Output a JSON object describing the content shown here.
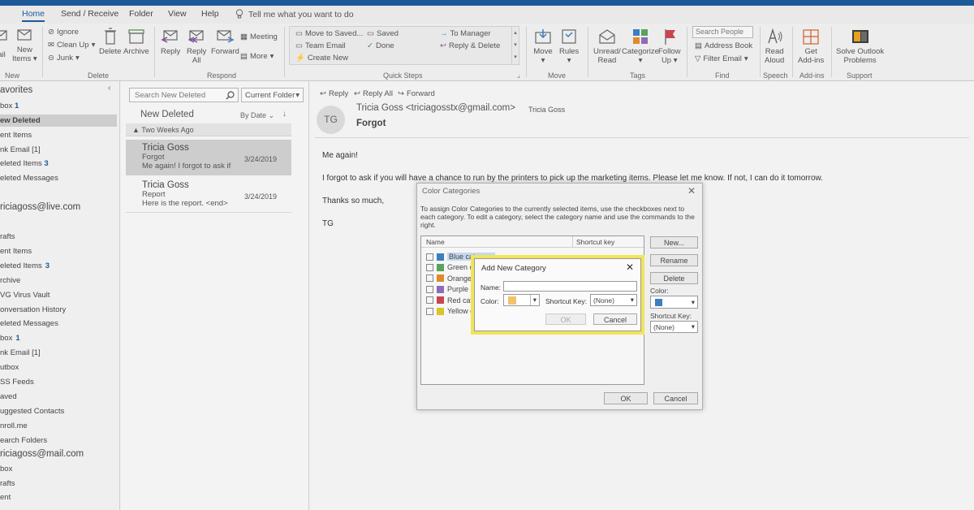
{
  "ribbon_tabs": [
    "Home",
    "Send / Receive",
    "Folder",
    "View",
    "Help"
  ],
  "tell_me": "Tell me what you want to do",
  "groups": {
    "new": "New",
    "delete": "Delete",
    "respond": "Respond",
    "quick_steps": "Quick Steps",
    "move": "Move",
    "tags": "Tags",
    "find": "Find",
    "speech": "Speech",
    "addins": "Add-ins",
    "support": "Support"
  },
  "buttons": {
    "new_email": "ail",
    "new_items_1": "New",
    "new_items_2": "Items",
    "ignore": "Ignore",
    "clean_up": "Clean Up",
    "junk": "Junk",
    "delete": "Delete",
    "archive": "Archive",
    "reply": "Reply",
    "reply_all_1": "Reply",
    "reply_all_2": "All",
    "forward": "Forward",
    "meeting": "Meeting",
    "more": "More",
    "qs_move": "Move to Saved...",
    "qs_team": "Team Email",
    "qs_create": "Create New",
    "qs_saved": "Saved",
    "qs_done": "Done",
    "qs_manager": "To Manager",
    "qs_reply_delete": "Reply & Delete",
    "move": "Move",
    "rules": "Rules",
    "unread_1": "Unread/",
    "unread_2": "Read",
    "categorize": "Categorize",
    "follow_1": "Follow",
    "follow_2": "Up",
    "search_people": "Search People",
    "address_book": "Address Book",
    "filter_email": "Filter Email",
    "read_1": "Read",
    "read_2": "Aloud",
    "get_1": "Get",
    "get_2": "Add-ins",
    "solve_1": "Solve Outlook",
    "solve_2": "Problems"
  },
  "folders": {
    "favorites": "avorites",
    "fav_items": [
      "box",
      "ew Deleted",
      "ent Items",
      "nk Email [1]",
      "eleted Items",
      "eleted Messages"
    ],
    "fav_counts": [
      "1",
      "",
      "",
      "",
      "3",
      ""
    ],
    "acct1": "riciagoss@live.com",
    "acct1_items": [
      "rafts",
      "ent Items",
      "eleted Items",
      "rchive",
      "VG Virus Vault",
      "onversation History",
      "eleted Messages",
      "box",
      "nk Email [1]",
      "utbox",
      "SS Feeds",
      "aved",
      "uggested Contacts",
      "nroll.me",
      "earch Folders"
    ],
    "acct1_counts": [
      "",
      "",
      "3",
      "",
      "",
      "",
      "",
      "1",
      "",
      "",
      "",
      "",
      "",
      "",
      ""
    ],
    "acct2": "riciagoss@mail.com",
    "acct2_items": [
      "box",
      "rafts",
      "ent"
    ]
  },
  "list": {
    "search_placeholder": "Search New Deleted",
    "scope": "Current Folder",
    "folder_name": "New Deleted",
    "sort": "By Date",
    "group": "Two Weeks Ago",
    "messages": [
      {
        "from": "Tricia Goss",
        "subject": "Forgot",
        "preview": "Me again!  I forgot to ask if",
        "date": "3/24/2019"
      },
      {
        "from": "Tricia Goss",
        "subject": "Report",
        "preview": "Here is the report. <end>",
        "date": "3/24/2019"
      }
    ]
  },
  "reading": {
    "reply": "Reply",
    "reply_all": "Reply All",
    "forward": "Forward",
    "initials": "TG",
    "from": "Tricia Goss <triciagosstx@gmail.com>",
    "to": "Tricia Goss",
    "subject": "Forgot",
    "body": [
      "Me again!",
      "I forgot to ask if you will have a chance to run by the printers to pick up the marketing items. Please let me know. If not, I can do it tomorrow.",
      "Thanks so much,",
      "TG"
    ]
  },
  "color_dialog": {
    "title": "Color Categories",
    "instructions": "To assign Color Categories to the currently selected items, use the checkboxes next to each category.  To edit a category, select the category name and use the commands to the right.",
    "col_name": "Name",
    "col_shortcut": "Shortcut key",
    "categories": [
      {
        "label": "Blue category",
        "color": "#3d7ec0"
      },
      {
        "label": "Green ca",
        "color": "#5aa25a"
      },
      {
        "label": "Orange c",
        "color": "#e08a2a"
      },
      {
        "label": "Purple c",
        "color": "#8f6bb5"
      },
      {
        "label": "Red cate",
        "color": "#c8454f"
      },
      {
        "label": "Yellow c",
        "color": "#d9c42a"
      }
    ],
    "new": "New...",
    "rename": "Rename",
    "delete": "Delete",
    "color_label": "Color:",
    "shortcut_label": "Shortcut Key:",
    "shortcut_value": "(None)",
    "ok": "OK",
    "cancel": "Cancel"
  },
  "add_dialog": {
    "title": "Add New Category",
    "name_label": "Name:",
    "name_value": "",
    "color_label": "Color:",
    "color_value": "#f5c16c",
    "shortcut_label": "Shortcut Key:",
    "shortcut_value": "(None)",
    "ok": "OK",
    "cancel": "Cancel",
    "highlight": "#f1e45a"
  }
}
